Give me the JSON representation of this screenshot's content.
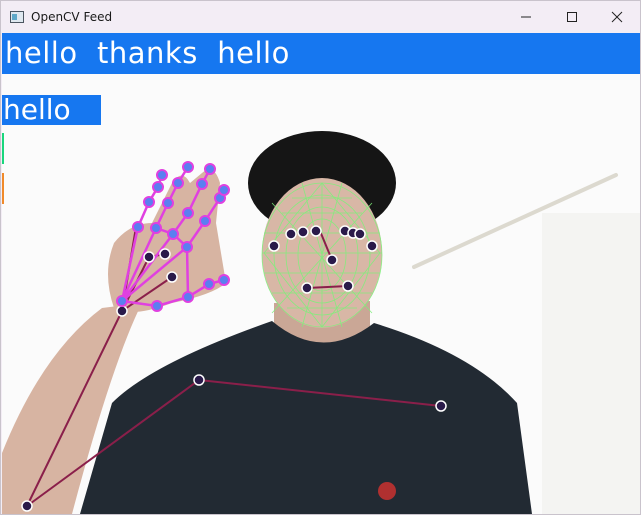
{
  "window": {
    "title": "OpenCV Feed",
    "controls": {
      "minimize": "minimize",
      "maximize": "maximize",
      "close": "close"
    }
  },
  "feed": {
    "sentence": "hello  thanks  hello",
    "prediction": "hello",
    "colors": {
      "banner": "#1677f0",
      "prediction_box": "#1677f0",
      "bar_2": "#1ad67c",
      "bar_3": "#f08a2a",
      "face_mesh": "#7ef07a",
      "landmark_fill": "#2a1a4a",
      "hand_landmark_ring": "#5a7ff0",
      "hand_connection": "#e040e0",
      "pose_connection": "#8a1f4a"
    }
  }
}
